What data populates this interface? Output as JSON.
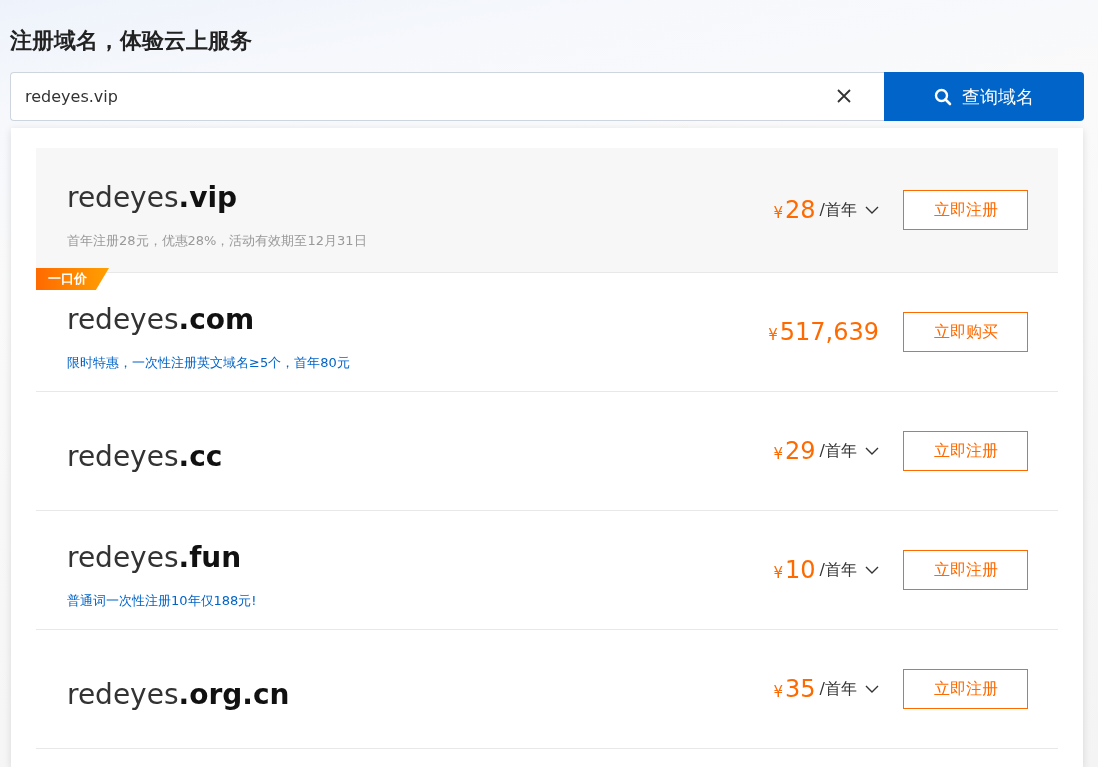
{
  "heading": "注册域名，体验云上服务",
  "search": {
    "value": "redeyes.vip",
    "button": "查询域名"
  },
  "results": [
    {
      "name": "redeyes",
      "tld": ".vip",
      "highlighted": true,
      "price_symbol": "¥",
      "price": "28",
      "period": "/首年",
      "note": {
        "kind": "muted",
        "text": "首年注册28元，优惠28%，活动有效期至12月31日"
      },
      "action": "立即注册"
    },
    {
      "name": "redeyes",
      "tld": ".com",
      "highlighted": false,
      "badge": "一口价",
      "price_symbol": "¥",
      "price": "517,639",
      "note": {
        "kind": "promo",
        "text": "限时特惠，一次性注册英文域名≥5个，首年80元"
      },
      "action": "立即购买"
    },
    {
      "name": "redeyes",
      "tld": ".cc",
      "highlighted": false,
      "price_symbol": "¥",
      "price": "29",
      "period": "/首年",
      "action": "立即注册"
    },
    {
      "name": "redeyes",
      "tld": ".fun",
      "highlighted": false,
      "price_symbol": "¥",
      "price": "10",
      "period": "/首年",
      "note": {
        "kind": "promo",
        "text": "普通词一次性注册10年仅188元!"
      },
      "action": "立即注册"
    },
    {
      "name": "redeyes",
      "tld": ".org.cn",
      "highlighted": false,
      "price_symbol": "¥",
      "price": "35",
      "period": "/首年",
      "action": "立即注册"
    }
  ]
}
